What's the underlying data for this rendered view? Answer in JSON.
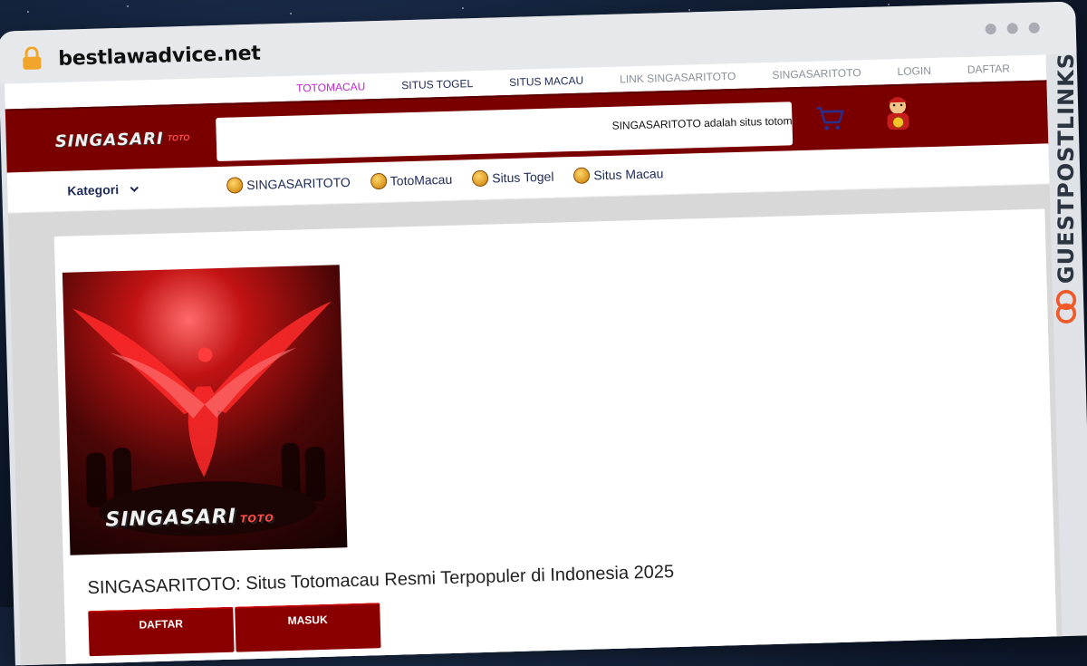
{
  "browser": {
    "url": "bestlawadvice.net"
  },
  "top_nav": {
    "items": [
      {
        "label": "TOTOMACAU",
        "active": true
      },
      {
        "label": "SITUS TOGEL"
      },
      {
        "label": "SITUS MACAU"
      },
      {
        "label": "LINK SINGASARITOTO",
        "muted": true
      },
      {
        "label": "SINGASARITOTO",
        "muted": true
      },
      {
        "label": "LOGIN",
        "muted": true
      },
      {
        "label": "DAFTAR",
        "muted": true
      }
    ]
  },
  "header": {
    "logo_text": "SINGASARI",
    "logo_sub": "TOTO",
    "search_text": "SINGASARITOTO adalah situs totom",
    "cart_icon": "cart-icon",
    "mascot_icon": "mascot-icon",
    "bg_color": "#7a0000"
  },
  "category_bar": {
    "kategori_label": "Kategori",
    "links": [
      "SINGASARITOTO",
      "TotoMacau",
      "Situs Togel",
      "Situs Macau"
    ]
  },
  "main": {
    "hero_logo": "SINGASARI",
    "hero_logo_sub": "TOTO",
    "headline": "SINGASARITOTO: Situs Totomacau Resmi Terpopuler di Indonesia 2025",
    "buttons": {
      "daftar": "DAFTAR",
      "masuk": "MASUK"
    }
  },
  "watermark": {
    "text": "GUESTPOSTLINKS",
    "accent_color": "#f05a28"
  }
}
